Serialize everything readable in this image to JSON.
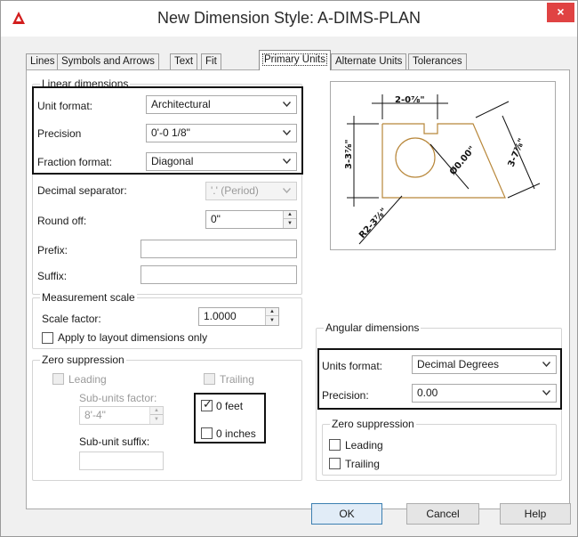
{
  "window": {
    "title": "New Dimension Style: A-DIMS-PLAN",
    "close_glyph": "×"
  },
  "tabs": [
    {
      "label": "Lines"
    },
    {
      "label": "Symbols and Arrows"
    },
    {
      "label": "Text"
    },
    {
      "label": "Fit"
    },
    {
      "label": "Primary Units",
      "active": true
    },
    {
      "label": "Alternate Units"
    },
    {
      "label": "Tolerances"
    }
  ],
  "linear": {
    "title": "Linear dimensions",
    "unit_format": {
      "label": "Unit format:",
      "value": "Architectural"
    },
    "precision": {
      "label": "Precision",
      "value": "0'-0 1/8\""
    },
    "fraction_format": {
      "label": "Fraction format:",
      "value": "Diagonal"
    },
    "decimal_separator": {
      "label": "Decimal separator:",
      "value": "'.' (Period)"
    },
    "round_off": {
      "label": "Round off:",
      "value": "0\""
    },
    "prefix": {
      "label": "Prefix:",
      "value": ""
    },
    "suffix": {
      "label": "Suffix:",
      "value": ""
    }
  },
  "measurement": {
    "title": "Measurement scale",
    "scale_factor": {
      "label": "Scale factor:",
      "value": "1.0000"
    },
    "apply_layout": {
      "label": "Apply to layout dimensions only",
      "checked": false
    }
  },
  "zero_linear": {
    "title": "Zero suppression",
    "leading": {
      "label": "Leading",
      "checked": false,
      "enabled": false
    },
    "trailing": {
      "label": "Trailing",
      "checked": false,
      "enabled": false
    },
    "sub_units_factor": {
      "label": "Sub-units factor:",
      "value": "8'-4\""
    },
    "sub_unit_suffix": {
      "label": "Sub-unit suffix:",
      "value": ""
    },
    "zero_feet": {
      "label": "0 feet",
      "checked": true
    },
    "zero_inches": {
      "label": "0 inches",
      "checked": false
    }
  },
  "preview": {
    "labels": {
      "top": "2-0⅞\"",
      "left": "3-3⅞\"",
      "right": "3-7⅞\"",
      "diameter": "Ø0.00\"",
      "radius": "R2-3⅞\""
    }
  },
  "angular": {
    "title": "Angular dimensions",
    "units_format": {
      "label": "Units format:",
      "value": "Decimal Degrees"
    },
    "precision": {
      "label": "Precision:",
      "value": "0.00"
    },
    "zero": {
      "title": "Zero suppression",
      "leading": {
        "label": "Leading",
        "checked": false
      },
      "trailing": {
        "label": "Trailing",
        "checked": false
      }
    }
  },
  "buttons": {
    "ok": "OK",
    "cancel": "Cancel",
    "help": "Help"
  },
  "colors": {
    "close": "#e04343",
    "highlight_box": "#111111",
    "preview_geometry": "#b8873a"
  }
}
